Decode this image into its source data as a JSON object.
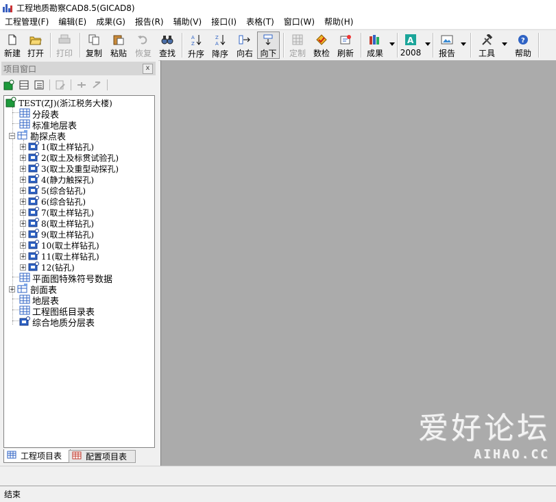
{
  "window": {
    "title": "工程地质勘察CAD8.5(GICAD8)"
  },
  "menu": [
    "工程管理(F)",
    "编辑(E)",
    "成果(G)",
    "报告(R)",
    "辅助(V)",
    "接口(I)",
    "表格(T)",
    "窗口(W)",
    "帮助(H)"
  ],
  "toolbar": {
    "new": "新建",
    "open": "打开",
    "print": "打印",
    "copy": "复制",
    "paste": "粘贴",
    "restore": "恢复",
    "find": "查找",
    "sort_asc": "升序",
    "sort_desc": "降序",
    "to_right": "向右",
    "to_down": "向下",
    "custom": "定制",
    "check": "数检",
    "refresh": "刷新",
    "results": "成果",
    "version": "2008",
    "report": "报告",
    "tools": "工具",
    "help": "帮助"
  },
  "project_window": {
    "title": "项目窗口",
    "close": "x",
    "root": "TEST(ZJ)(浙江税务大楼)",
    "items": {
      "segment": "分段表",
      "strata_standard": "标准地层表",
      "exploration": "勘探点表",
      "holes": [
        "1(取土样钻孔)",
        "2(取土及标贯试验孔)",
        "3(取土及重型动探孔)",
        "4(静力触探孔)",
        "5(综合钻孔)",
        "6(综合钻孔)",
        "7(取土样钻孔)",
        "8(取土样钻孔)",
        "9(取土样钻孔)",
        "10(取土样钻孔)",
        "11(取土样钻孔)",
        "12(钻孔)"
      ],
      "plan_symbols": "平面图特殊符号数据",
      "sections": "剖面表",
      "strata": "地层表",
      "drawing_catalog": "工程图纸目录表",
      "geo_layers": "综合地质分层表"
    },
    "tabs": {
      "project": "工程项目表",
      "config": "配置项目表"
    }
  },
  "watermark": {
    "big": "爱好论坛",
    "small": "AIHAO.CC"
  },
  "status": {
    "text": "结束"
  },
  "colors": {
    "workspace": "#ababab",
    "icon_blue": "#2f63c4",
    "icon_green": "#1d9a3b"
  }
}
